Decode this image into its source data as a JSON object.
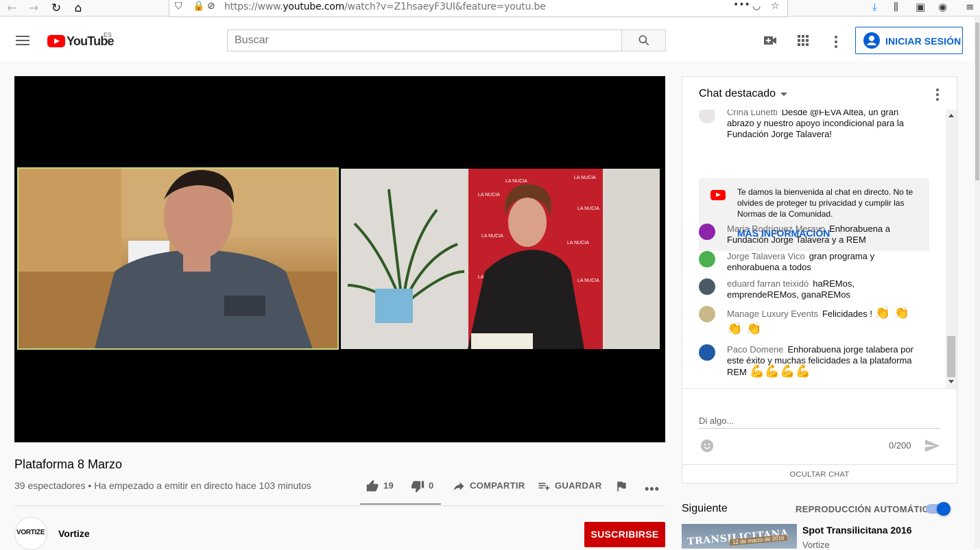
{
  "browser": {
    "url_prefix": "https://www.",
    "url_domain": "youtube.com",
    "url_path": "/watch?v=Z1hsaeyF3UI&feature=youtu.be"
  },
  "header": {
    "logo_text": "YouTube",
    "country": "ES",
    "search_placeholder": "Buscar",
    "signin_label": "INICIAR SESIÓN"
  },
  "video": {
    "title": "Plataforma 8 Marzo",
    "meta": "39 espectadores • Ha empezado a emitir en directo hace 103 minutos",
    "likes": "19",
    "dislikes": "0",
    "like_ratio": 1.0,
    "share_label": "COMPARTIR",
    "save_label": "GUARDAR",
    "backdrop_text": "LA NUCIA"
  },
  "channel": {
    "avatar_text": "VORTIZE",
    "name": "Vortize",
    "subscribe_label": "SUSCRIBIRSE"
  },
  "chat": {
    "title": "Chat destacado",
    "messages": [
      {
        "author": "Crina Lunetti",
        "text": "Desde @FEVA Altea, un gran abrazo y nuestro apoyo incondicional para la Fundación Jorge Talavera!",
        "emoji": "",
        "avatar_color": "#e9e4e8"
      },
      {
        "author": "Maria Rodríguez Merayo",
        "text": "Enhorabuena a Fundación Jorge Talavera y a REM",
        "emoji": "",
        "avatar_color": "#8e24aa"
      },
      {
        "author": "Jorge Talavera Vico",
        "text": "gran programa y enhorabuena a todos",
        "emoji": "",
        "avatar_color": "#4caf50"
      },
      {
        "author": "eduard farran teixidó",
        "text": "haREMos, emprendeREMos, ganaREMos",
        "emoji": "",
        "avatar_color": "#4a5b66"
      },
      {
        "author": "Manage Luxury Events",
        "text": "Felicidades !",
        "emoji": "👏 👏 👏 👏",
        "avatar_color": "#c9b98a"
      },
      {
        "author": "Paco Domene",
        "text": "Enhorabuena jorge talabera por este éxito y muchas felicidades a la plataforma REM",
        "emoji": "💪💪💪💪",
        "avatar_color": "#1e5aa8"
      }
    ],
    "welcome_text": "Te damos la bienvenida al chat en directo. No te olvides de proteger tu privacidad y cumplir las Normas de la Comunidad.",
    "welcome_more": "MÁS INFORMACIÓN",
    "input_placeholder": "Di algo...",
    "counter": "0/200",
    "hide_label": "OCULTAR CHAT"
  },
  "upnext": {
    "title": "Siguiente",
    "autoplay_label": "REPRODUCCIÓN AUTOMÁTICA",
    "autoplay_on": true,
    "thumb_text": "TRANSILICITANA",
    "thumb_date": "12 de marzo de 2016",
    "video_title": "Spot Transilicitana 2016",
    "video_channel": "Vortize"
  },
  "colors": {
    "brand_red": "#ff0000",
    "accent_blue": "#065fd4",
    "subscribe_red": "#cc0000"
  }
}
